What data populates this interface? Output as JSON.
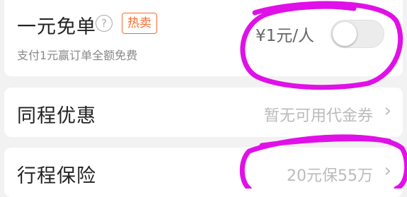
{
  "free_order": {
    "title": "一元免单",
    "help_icon": "question-circle-icon",
    "help_glyph": "?",
    "badge": "热卖",
    "subtitle": "支付1元赢订单全额免费",
    "price": "¥1元/人",
    "toggle_on": false
  },
  "discount": {
    "label": "同程优惠",
    "value": "暂无可用代金券",
    "chevron": "›"
  },
  "insurance": {
    "label": "行程保险",
    "value": "20元保55万",
    "chevron": "›"
  },
  "colors": {
    "accent": "#ff6a2b",
    "annotation": "#e010e8"
  }
}
